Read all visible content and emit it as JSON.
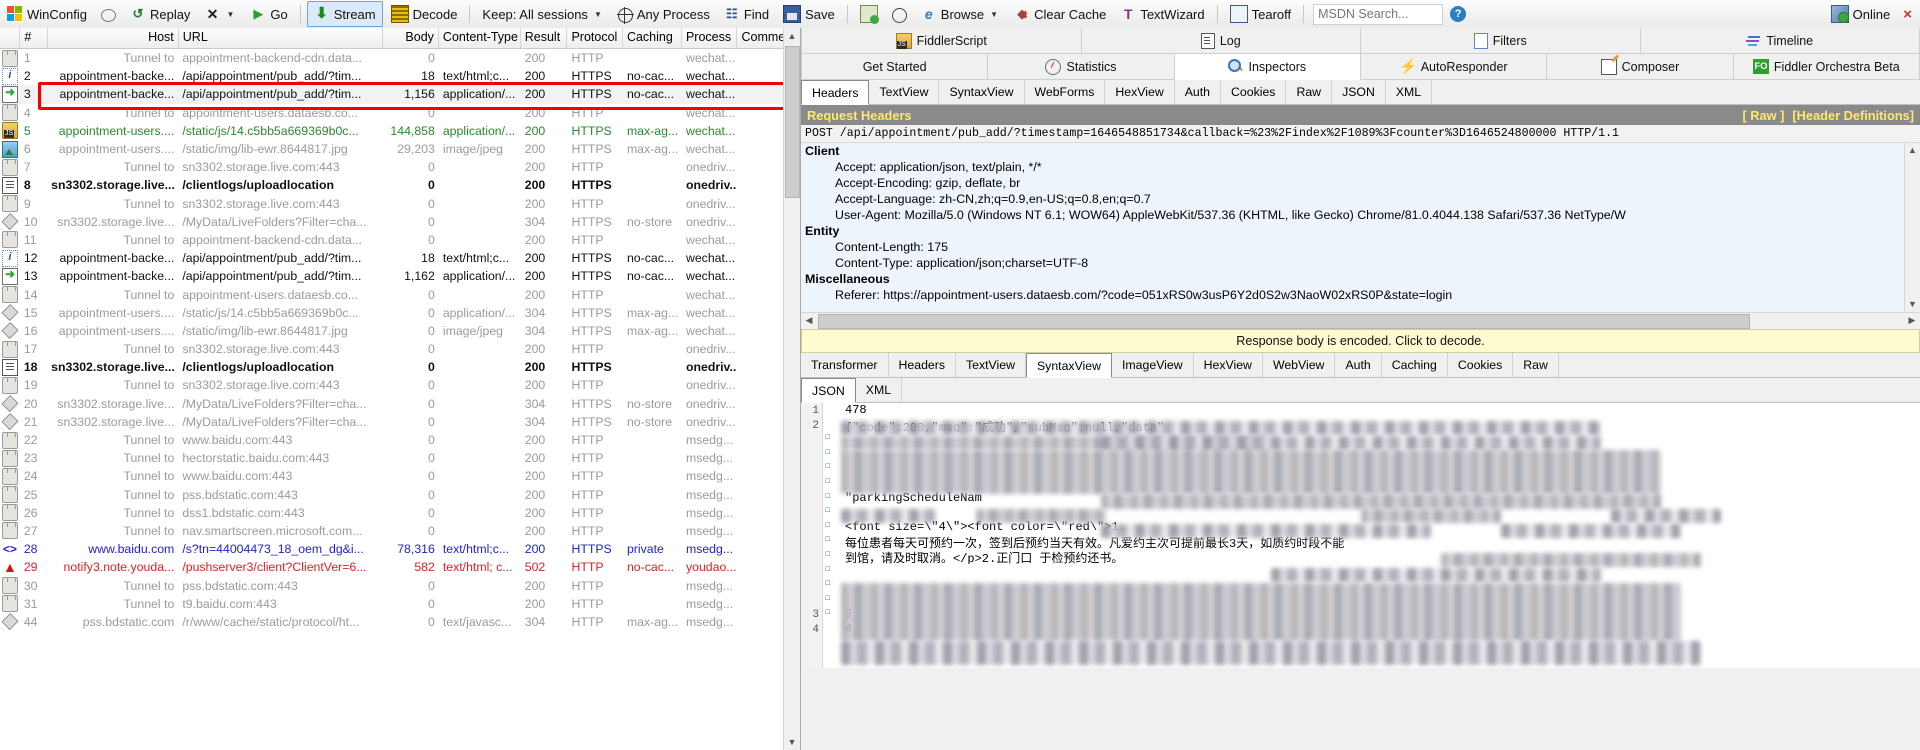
{
  "toolbar": {
    "winconfig": "WinConfig",
    "replay": "Replay",
    "clear": "X",
    "go": "Go",
    "stream": "Stream",
    "decode": "Decode",
    "keep": "Keep: All sessions",
    "any_process": "Any Process",
    "find": "Find",
    "save": "Save",
    "browse": "Browse",
    "clear_cache": "Clear Cache",
    "textwizard": "TextWizard",
    "tearoff": "Tearoff",
    "msdn_search_placeholder": "MSDN Search...",
    "online": "Online",
    "close": "×"
  },
  "sessions": {
    "columns": [
      "#",
      "Host",
      "URL",
      "Body",
      "Content-Type",
      "Result",
      "Protocol",
      "Caching",
      "Process",
      "Comments"
    ],
    "selected_row_id": "3",
    "rows": [
      {
        "icon": "lock-icon",
        "num": "1",
        "host": "Tunnel to",
        "url": "appointment-backend-cdn.data...",
        "body": "0",
        "ctype": "",
        "result": "200",
        "proto": "HTTP",
        "caching": "",
        "process": "wechat...",
        "comments": "",
        "style": "g-grey"
      },
      {
        "icon": "info-icon",
        "num": "2",
        "host": "appointment-backe...",
        "url": "/api/appointment/pub_add/?tim...",
        "body": "18",
        "ctype": "text/html;c...",
        "result": "200",
        "proto": "HTTPS",
        "caching": "no-cac...",
        "process": "wechat...",
        "comments": "",
        "style": "g-black"
      },
      {
        "icon": "arrow-icon",
        "num": "3",
        "host": "appointment-backe...",
        "url": "/api/appointment/pub_add/?tim...",
        "body": "1,156",
        "ctype": "application/...",
        "result": "200",
        "proto": "HTTPS",
        "caching": "no-cac...",
        "process": "wechat...",
        "comments": "",
        "style": "g-black"
      },
      {
        "icon": "lock-icon",
        "num": "4",
        "host": "Tunnel to",
        "url": "appointment-users.dataesb.co...",
        "body": "0",
        "ctype": "",
        "result": "200",
        "proto": "HTTP",
        "caching": "",
        "process": "wechat...",
        "comments": "",
        "style": "g-grey"
      },
      {
        "icon": "js-icon",
        "num": "5",
        "host": "appointment-users....",
        "url": "/static/js/14.c5bb5a669369b0c...",
        "body": "144,858",
        "ctype": "application/...",
        "result": "200",
        "proto": "HTTPS",
        "caching": "max-ag...",
        "process": "wechat...",
        "comments": "",
        "style": "g-green"
      },
      {
        "icon": "image-icon",
        "num": "6",
        "host": "appointment-users....",
        "url": "/static/img/lib-ewr.8644817.jpg",
        "body": "29,203",
        "ctype": "image/jpeg",
        "result": "200",
        "proto": "HTTPS",
        "caching": "max-ag...",
        "process": "wechat...",
        "comments": "",
        "style": "g-grey"
      },
      {
        "icon": "lock-icon",
        "num": "7",
        "host": "Tunnel to",
        "url": "sn3302.storage.live.com:443",
        "body": "0",
        "ctype": "",
        "result": "200",
        "proto": "HTTP",
        "caching": "",
        "process": "onedriv...",
        "comments": "",
        "style": "g-grey"
      },
      {
        "icon": "doc-icon",
        "num": "8",
        "host": "sn3302.storage.live...",
        "url": "/clientlogs/uploadlocation",
        "body": "0",
        "ctype": "",
        "result": "200",
        "proto": "HTTPS",
        "caching": "",
        "process": "onedriv...",
        "comments": "",
        "style": "g-bold"
      },
      {
        "icon": "lock-icon",
        "num": "9",
        "host": "Tunnel to",
        "url": "sn3302.storage.live.com:443",
        "body": "0",
        "ctype": "",
        "result": "200",
        "proto": "HTTP",
        "caching": "",
        "process": "onedriv...",
        "comments": "",
        "style": "g-grey"
      },
      {
        "icon": "diamond-icon",
        "num": "10",
        "host": "sn3302.storage.live...",
        "url": "/MyData/LiveFolders?Filter=cha...",
        "body": "0",
        "ctype": "",
        "result": "304",
        "proto": "HTTPS",
        "caching": "no-store",
        "process": "onedriv...",
        "comments": "",
        "style": "g-grey"
      },
      {
        "icon": "lock-icon",
        "num": "11",
        "host": "Tunnel to",
        "url": "appointment-backend-cdn.data...",
        "body": "0",
        "ctype": "",
        "result": "200",
        "proto": "HTTP",
        "caching": "",
        "process": "wechat...",
        "comments": "",
        "style": "g-grey"
      },
      {
        "icon": "info-icon",
        "num": "12",
        "host": "appointment-backe...",
        "url": "/api/appointment/pub_add/?tim...",
        "body": "18",
        "ctype": "text/html;c...",
        "result": "200",
        "proto": "HTTPS",
        "caching": "no-cac...",
        "process": "wechat...",
        "comments": "",
        "style": "g-black"
      },
      {
        "icon": "arrow-icon",
        "num": "13",
        "host": "appointment-backe...",
        "url": "/api/appointment/pub_add/?tim...",
        "body": "1,162",
        "ctype": "application/...",
        "result": "200",
        "proto": "HTTPS",
        "caching": "no-cac...",
        "process": "wechat...",
        "comments": "",
        "style": "g-black"
      },
      {
        "icon": "lock-icon",
        "num": "14",
        "host": "Tunnel to",
        "url": "appointment-users.dataesb.co...",
        "body": "0",
        "ctype": "",
        "result": "200",
        "proto": "HTTP",
        "caching": "",
        "process": "wechat...",
        "comments": "",
        "style": "g-grey"
      },
      {
        "icon": "diamond-icon",
        "num": "15",
        "host": "appointment-users....",
        "url": "/static/js/14.c5bb5a669369b0c...",
        "body": "0",
        "ctype": "application/...",
        "result": "304",
        "proto": "HTTPS",
        "caching": "max-ag...",
        "process": "wechat...",
        "comments": "",
        "style": "g-grey"
      },
      {
        "icon": "diamond-icon",
        "num": "16",
        "host": "appointment-users....",
        "url": "/static/img/lib-ewr.8644817.jpg",
        "body": "0",
        "ctype": "image/jpeg",
        "result": "304",
        "proto": "HTTPS",
        "caching": "max-ag...",
        "process": "wechat...",
        "comments": "",
        "style": "g-grey"
      },
      {
        "icon": "lock-icon",
        "num": "17",
        "host": "Tunnel to",
        "url": "sn3302.storage.live.com:443",
        "body": "0",
        "ctype": "",
        "result": "200",
        "proto": "HTTP",
        "caching": "",
        "process": "onedriv...",
        "comments": "",
        "style": "g-grey"
      },
      {
        "icon": "doc-icon",
        "num": "18",
        "host": "sn3302.storage.live...",
        "url": "/clientlogs/uploadlocation",
        "body": "0",
        "ctype": "",
        "result": "200",
        "proto": "HTTPS",
        "caching": "",
        "process": "onedriv...",
        "comments": "",
        "style": "g-bold"
      },
      {
        "icon": "lock-icon",
        "num": "19",
        "host": "Tunnel to",
        "url": "sn3302.storage.live.com:443",
        "body": "0",
        "ctype": "",
        "result": "200",
        "proto": "HTTP",
        "caching": "",
        "process": "onedriv...",
        "comments": "",
        "style": "g-grey"
      },
      {
        "icon": "diamond-icon",
        "num": "20",
        "host": "sn3302.storage.live...",
        "url": "/MyData/LiveFolders?Filter=cha...",
        "body": "0",
        "ctype": "",
        "result": "304",
        "proto": "HTTPS",
        "caching": "no-store",
        "process": "onedriv...",
        "comments": "",
        "style": "g-grey"
      },
      {
        "icon": "diamond-icon",
        "num": "21",
        "host": "sn3302.storage.live...",
        "url": "/MyData/LiveFolders?Filter=cha...",
        "body": "0",
        "ctype": "",
        "result": "304",
        "proto": "HTTPS",
        "caching": "no-store",
        "process": "onedriv...",
        "comments": "",
        "style": "g-grey"
      },
      {
        "icon": "lock-icon",
        "num": "22",
        "host": "Tunnel to",
        "url": "www.baidu.com:443",
        "body": "0",
        "ctype": "",
        "result": "200",
        "proto": "HTTP",
        "caching": "",
        "process": "msedg...",
        "comments": "",
        "style": "g-grey"
      },
      {
        "icon": "lock-icon",
        "num": "23",
        "host": "Tunnel to",
        "url": "hectorstatic.baidu.com:443",
        "body": "0",
        "ctype": "",
        "result": "200",
        "proto": "HTTP",
        "caching": "",
        "process": "msedg...",
        "comments": "",
        "style": "g-grey"
      },
      {
        "icon": "lock-icon",
        "num": "24",
        "host": "Tunnel to",
        "url": "www.baidu.com:443",
        "body": "0",
        "ctype": "",
        "result": "200",
        "proto": "HTTP",
        "caching": "",
        "process": "msedg...",
        "comments": "",
        "style": "g-grey"
      },
      {
        "icon": "lock-icon",
        "num": "25",
        "host": "Tunnel to",
        "url": "pss.bdstatic.com:443",
        "body": "0",
        "ctype": "",
        "result": "200",
        "proto": "HTTP",
        "caching": "",
        "process": "msedg...",
        "comments": "",
        "style": "g-grey"
      },
      {
        "icon": "lock-icon",
        "num": "26",
        "host": "Tunnel to",
        "url": "dss1.bdstatic.com:443",
        "body": "0",
        "ctype": "",
        "result": "200",
        "proto": "HTTP",
        "caching": "",
        "process": "msedg...",
        "comments": "",
        "style": "g-grey"
      },
      {
        "icon": "lock-icon",
        "num": "27",
        "host": "Tunnel to",
        "url": "nav.smartscreen.microsoft.com...",
        "body": "0",
        "ctype": "",
        "result": "200",
        "proto": "HTTP",
        "caching": "",
        "process": "msedg...",
        "comments": "",
        "style": "g-grey"
      },
      {
        "icon": "code-icon",
        "num": "28",
        "host": "www.baidu.com",
        "url": "/s?tn=44004473_18_oem_dg&i...",
        "body": "78,316",
        "ctype": "text/html;c...",
        "result": "200",
        "proto": "HTTPS",
        "caching": "private",
        "process": "msedg...",
        "comments": "",
        "style": "g-blue"
      },
      {
        "icon": "warn-icon",
        "num": "29",
        "host": "notify3.note.youda...",
        "url": "/pushserver3/client?ClientVer=6...",
        "body": "582",
        "ctype": "text/html; c...",
        "result": "502",
        "proto": "HTTP",
        "caching": "no-cac...",
        "process": "youdao...",
        "comments": "",
        "style": "g-red"
      },
      {
        "icon": "lock-icon",
        "num": "30",
        "host": "Tunnel to",
        "url": "pss.bdstatic.com:443",
        "body": "0",
        "ctype": "",
        "result": "200",
        "proto": "HTTP",
        "caching": "",
        "process": "msedg...",
        "comments": "",
        "style": "g-grey"
      },
      {
        "icon": "lock-icon",
        "num": "31",
        "host": "Tunnel to",
        "url": "t9.baidu.com:443",
        "body": "0",
        "ctype": "",
        "result": "200",
        "proto": "HTTP",
        "caching": "",
        "process": "msedg...",
        "comments": "",
        "style": "g-grey"
      },
      {
        "icon": "diamond-icon",
        "num": "44",
        "host": "pss.bdstatic.com",
        "url": "/r/www/cache/static/protocol/ht...",
        "body": "0",
        "ctype": "text/javasc...",
        "result": "304",
        "proto": "HTTP",
        "caching": "max-ag...",
        "process": "msedg...",
        "comments": "",
        "style": "g-grey"
      }
    ]
  },
  "right_panel": {
    "top_tabs": [
      {
        "label": "FiddlerScript",
        "icon": "fiddlerscript-icon",
        "active": false
      },
      {
        "label": "Log",
        "icon": "log-icon",
        "active": false
      },
      {
        "label": "Filters",
        "icon": "filters-icon",
        "active": false
      },
      {
        "label": "Timeline",
        "icon": "timeline-icon",
        "active": false
      }
    ],
    "main_tabs": [
      {
        "label": "Get Started",
        "icon": "",
        "active": false
      },
      {
        "label": "Statistics",
        "icon": "statistics-icon",
        "active": false
      },
      {
        "label": "Inspectors",
        "icon": "inspectors-icon",
        "active": true
      },
      {
        "label": "AutoResponder",
        "icon": "bolt-icon",
        "active": false
      },
      {
        "label": "Composer",
        "icon": "composer-icon",
        "active": false
      },
      {
        "label": "Fiddler Orchestra Beta",
        "icon": "orchestra-icon",
        "active": false
      }
    ],
    "request": {
      "tabs": [
        "Headers",
        "TextView",
        "SyntaxView",
        "WebForms",
        "HexView",
        "Auth",
        "Cookies",
        "Raw",
        "JSON",
        "XML"
      ],
      "active_tab": "Headers",
      "bar_title": "Request Headers",
      "bar_links": [
        "[ Raw ]",
        "[Header Definitions]"
      ],
      "request_line": "POST  /api/appointment/pub_add/?timestamp=1646548851734&callback=%23%2Findex%2F1089%3Fcounter%3D1646524800000 HTTP/1.1",
      "groups": [
        {
          "name": "Client",
          "items": [
            "Accept: application/json, text/plain, */*",
            "Accept-Encoding: gzip, deflate, br",
            "Accept-Language: zh-CN,zh;q=0.9,en-US;q=0.8,en;q=0.7",
            "User-Agent: Mozilla/5.0 (Windows NT 6.1; WOW64) AppleWebKit/537.36 (KHTML, like Gecko) Chrome/81.0.4044.138 Safari/537.36 NetType/W"
          ]
        },
        {
          "name": "Entity",
          "items": [
            "Content-Length: 175",
            "Content-Type: application/json;charset=UTF-8"
          ]
        },
        {
          "name": "Miscellaneous",
          "items": [
            "Referer: https://appointment-users.dataesb.com/?code=051xRS0w3usP6Y2d0S2w3NaoW02xRS0P&state=login"
          ]
        }
      ]
    },
    "response": {
      "decode_notice": "Response body is encoded. Click to decode.",
      "tabs": [
        "Transformer",
        "Headers",
        "TextView",
        "SyntaxView",
        "ImageView",
        "HexView",
        "WebView",
        "Auth",
        "Caching",
        "Cookies",
        "Raw"
      ],
      "active_tab": "SyntaxView",
      "subtabs": [
        "JSON",
        "XML"
      ],
      "active_subtab": "JSON",
      "line_numbers": [
        "1",
        "2",
        "",
        "",
        "",
        "",
        "",
        "",
        "",
        "",
        "",
        "",
        "",
        "",
        "3",
        "4"
      ],
      "lines": [
        "478",
        "{\"code\":200,\"msg\":\"成功\",\"subMsg\":null,\"data\"",
        "",
        "",
        "",
        "",
        "\"parkingScheduleNam",
        "",
        "<font size=\\\"4\\\"><font color=\\\"red\\\">1.",
        "每位患者每天可预约一次，签到后预约当天有效。凡爱约主次可提前最长3天，如质约时段不能",
        "到馆，请及时取消。</p>2.正门口      于检预约还书。",
        "",
        "",
        "",
        "3",
        "4"
      ]
    }
  }
}
